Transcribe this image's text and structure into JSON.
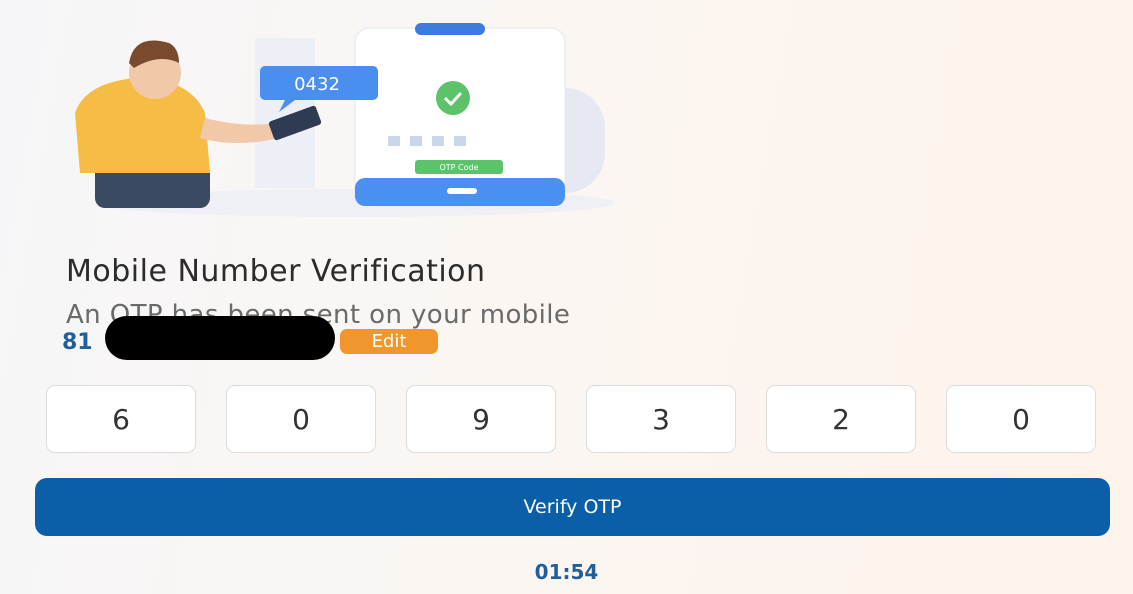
{
  "header": {
    "title": "Mobile Number Verification",
    "subtitle": "An OTP has been sent on your mobile"
  },
  "phone": {
    "visible_prefix": "81",
    "edit_label": "Edit"
  },
  "illustration": {
    "bubble_code": "0432",
    "button_label": "OTP Code"
  },
  "otp": {
    "digits": [
      "6",
      "0",
      "9",
      "3",
      "2",
      "0"
    ]
  },
  "actions": {
    "verify_label": "Verify OTP"
  },
  "timer": {
    "value": "01:54"
  },
  "colors": {
    "primary": "#0b5ea8",
    "accent": "#f0962c",
    "text_link": "#1f5f9c"
  }
}
